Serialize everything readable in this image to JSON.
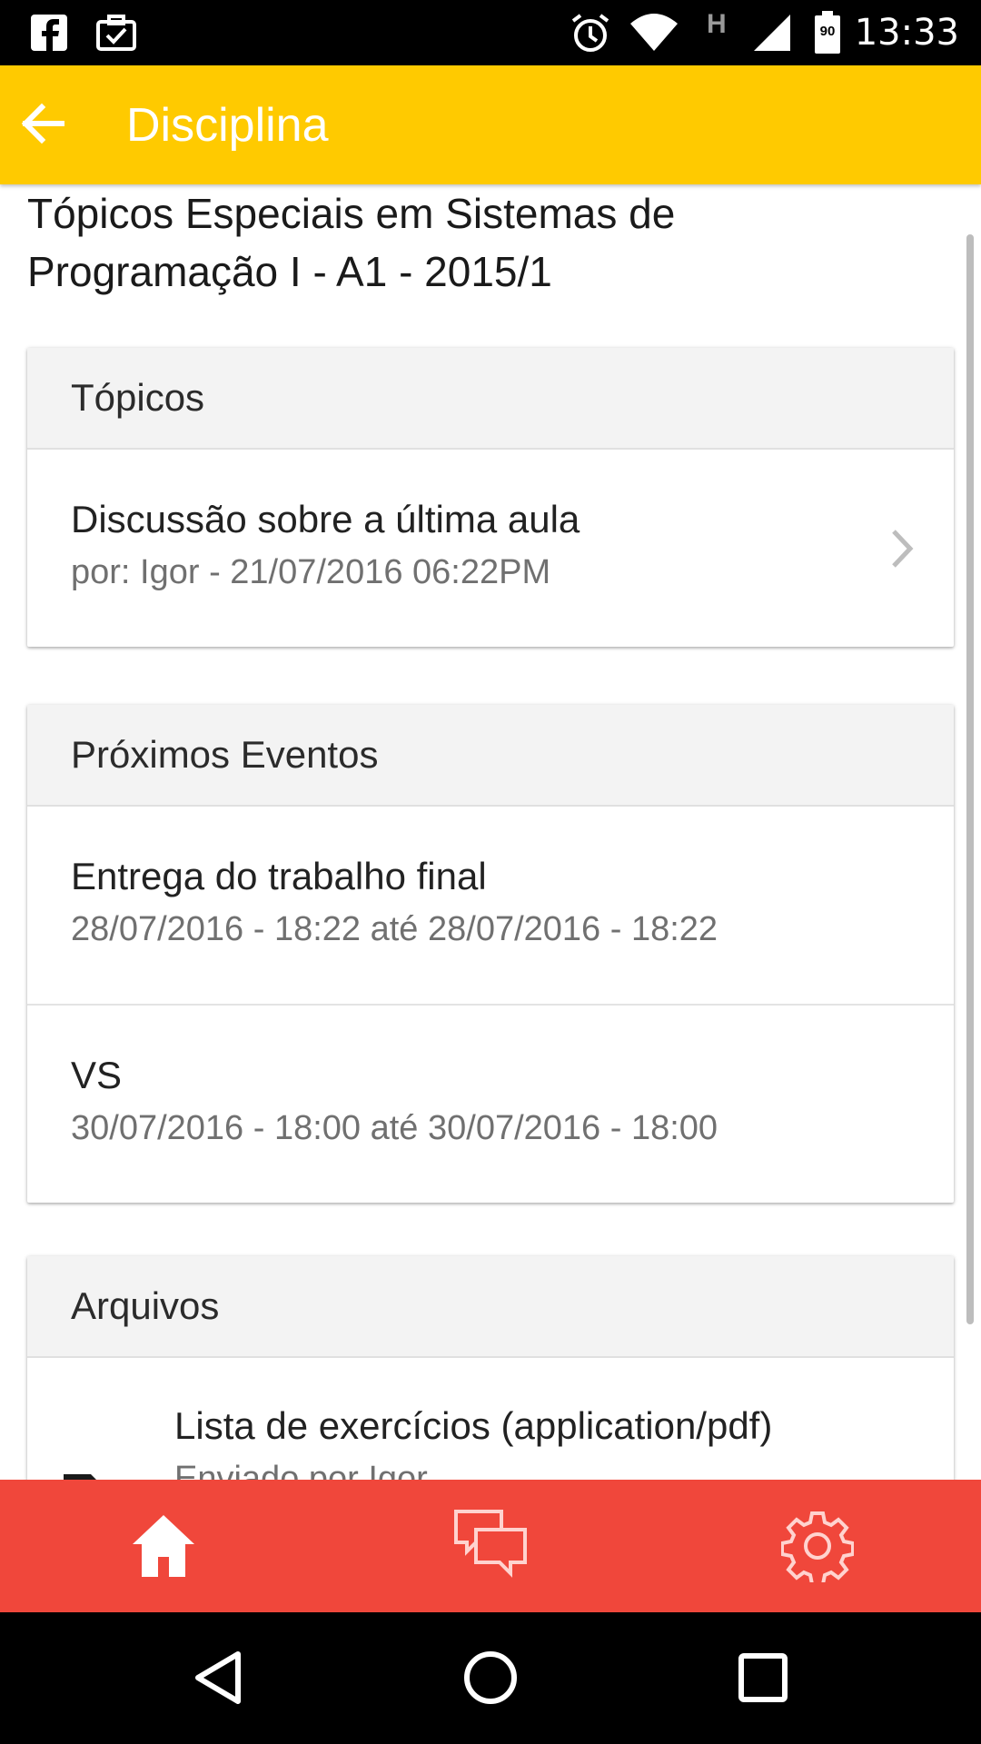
{
  "status_bar": {
    "time": "13:33",
    "battery_level": "90",
    "network_type": "H",
    "icons": [
      "facebook-icon",
      "clipboard-check-icon",
      "alarm-icon",
      "wifi-icon",
      "network-type-icon",
      "signal-icon",
      "battery-icon"
    ]
  },
  "app_bar": {
    "title": "Disciplina",
    "back_icon": "arrow-back-icon",
    "color": "#ffca00"
  },
  "course": {
    "title": "Tópicos Especiais em Sistemas de Programação I - A1 - 2015/1"
  },
  "topics": {
    "header": "Tópicos",
    "items": [
      {
        "title": "Discussão sobre a última aula",
        "subtitle": "por: Igor - 21/07/2016 06:22PM"
      }
    ]
  },
  "events": {
    "header": "Próximos Eventos",
    "items": [
      {
        "title": "Entrega do trabalho final",
        "subtitle": "28/07/2016 - 18:22 até 28/07/2016 - 18:22"
      },
      {
        "title": "VS",
        "subtitle": "30/07/2016 - 18:00 até 30/07/2016 - 18:00"
      }
    ]
  },
  "files": {
    "header": "Arquivos",
    "items": [
      {
        "title": "Lista de exercícios (application/pdf)",
        "subtitle": "Enviado por Igor"
      }
    ]
  },
  "bottom_nav": {
    "color": "#f0473b",
    "items": [
      {
        "name": "home-icon",
        "active": true
      },
      {
        "name": "chat-icon",
        "active": false
      },
      {
        "name": "settings-icon",
        "active": false
      }
    ]
  },
  "system_nav": {
    "items": [
      "back-triangle-icon",
      "home-circle-icon",
      "recents-square-icon"
    ]
  }
}
